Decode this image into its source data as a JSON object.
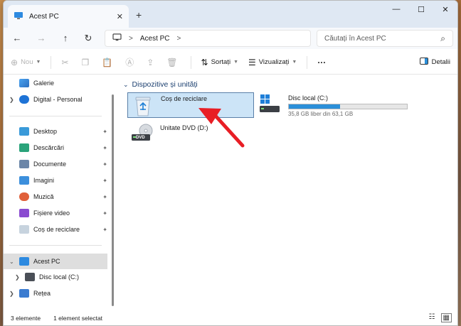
{
  "window": {
    "tab_title": "Acest PC",
    "tab_close": "✕",
    "new_tab": "+",
    "minimize": "—",
    "maximize": "☐",
    "close": "✕"
  },
  "address": {
    "back": "←",
    "forward": "→",
    "up": "↑",
    "refresh": "↻",
    "path_root_sep": ">",
    "path": "Acest PC",
    "path_sep": ">",
    "search_placeholder": "Căutați în Acest PC",
    "search_icon": "⌕"
  },
  "toolbar": {
    "new_label": "Nou",
    "sort_label": "Sortați",
    "view_label": "Vizualizați",
    "more_label": "···",
    "details_label": "Detalii"
  },
  "sidebar": {
    "items": [
      {
        "label": "Galerie"
      },
      {
        "label": "Digital - Personal"
      },
      {
        "label": "Desktop"
      },
      {
        "label": "Descărcări"
      },
      {
        "label": "Documente"
      },
      {
        "label": "Imagini"
      },
      {
        "label": "Muzică"
      },
      {
        "label": "Fișiere video"
      },
      {
        "label": "Coș de reciclare"
      },
      {
        "label": "Acest PC"
      },
      {
        "label": "Disc local (C:)"
      },
      {
        "label": "Rețea"
      }
    ],
    "pin": "📌"
  },
  "main": {
    "group_title": "Dispozitive și unități",
    "recycle_bin": "Coș de reciclare",
    "dvd": "Unitate DVD (D:)",
    "dvd_badge": "DVD",
    "local_disk": {
      "name": "Disc local (C:)",
      "size_text": "35,8 GB liber din 63,1 GB",
      "used_fraction": 0.433
    }
  },
  "status": {
    "count": "3 elemente",
    "selected": "1 element selectat"
  },
  "colors": {
    "accent": "#2b8fd9",
    "selection_bg": "#cce4f7",
    "arrow": "#e81e25"
  }
}
